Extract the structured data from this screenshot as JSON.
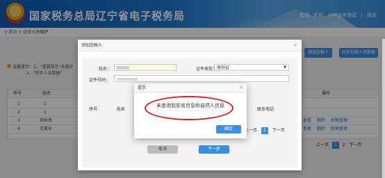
{
  "header": {
    "title": "国家税务总局辽宁省电子税务局",
    "links": [
      "首页",
      "欢迎，APP业务测试",
      "|",
      "退出"
    ]
  },
  "breadcrumb": {
    "home": "首页",
    "sep": ">",
    "current": "企业人员维护"
  },
  "page": {
    "add_btn": "添加办税人",
    "add_new_btn": "同步办税人员数据",
    "notice_line1": "温馨提示：1、\"重要提示\"未维护",
    "notice_line2": "2、\"同步人员数据\"",
    "table_headers": [
      "序号",
      "姓名",
      "",
      "操作"
    ],
    "rows": [
      {
        "no": "1",
        "name": "1"
      },
      {
        "no": "2",
        "name": "1"
      },
      {
        "no": "3",
        "name": "邓长沛"
      },
      {
        "no": "4",
        "name": "王美众"
      }
    ],
    "row_actions": [
      "查看",
      "删除",
      "权限管理"
    ],
    "pager": {
      "prev": "上一页",
      "p1": "1",
      "p2": "2",
      "next": "下一页"
    }
  },
  "dialog_add": {
    "title": "添加办税人",
    "close": "×",
    "name_label": "姓名：",
    "id_type_label": "证件类型：",
    "id_type_value": "身份证",
    "id_no_label": "证件号码：",
    "table_headers": [
      "序号",
      "姓名",
      "联系电话"
    ],
    "pager": {
      "prev": "上一页",
      "p1": "1",
      "next": "下一页"
    },
    "cancel": "取消",
    "next": "下一步"
  },
  "dialog_tip": {
    "title": "提示",
    "close": "×",
    "message": "未查询到实名信息和自然人信息",
    "ok": "确定"
  },
  "colors": {
    "accent": "#3a8ee6",
    "highlight": "#d91e1e"
  }
}
